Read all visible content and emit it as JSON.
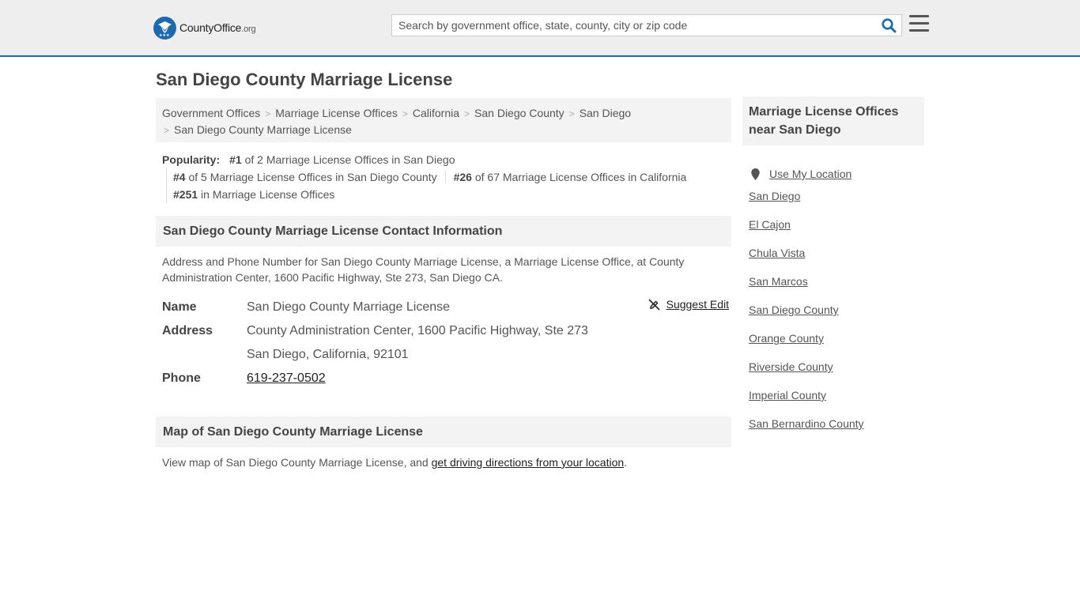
{
  "header": {
    "logo_brand": "CountyOffice",
    "logo_tld": ".org",
    "search_placeholder": "Search by government office, state, county, city or zip code"
  },
  "page_title": "San Diego County Marriage License",
  "breadcrumb": [
    "Government Offices",
    "Marriage License Offices",
    "California",
    "San Diego County",
    "San Diego",
    "San Diego County Marriage License"
  ],
  "popularity": {
    "label": "Popularity:",
    "items": [
      {
        "rank": "#1",
        "text": " of 2 Marriage License Offices in San Diego"
      },
      {
        "rank": "#4",
        "text": " of 5 Marriage License Offices in San Diego County"
      },
      {
        "rank": "#26",
        "text": " of 67 Marriage License Offices in California"
      },
      {
        "rank": "#251",
        "text": " in Marriage License Offices"
      }
    ]
  },
  "contact": {
    "heading": "San Diego County Marriage License Contact Information",
    "description": "Address and Phone Number for San Diego County Marriage License, a Marriage License Office, at County Administration Center, 1600 Pacific Highway, Ste 273, San Diego CA.",
    "suggest_edit": "Suggest Edit",
    "name_label": "Name",
    "name": "San Diego County Marriage License",
    "address_label": "Address",
    "address_line1": "County Administration Center, 1600 Pacific Highway, Ste 273",
    "address_line2": "San Diego, California, 92101",
    "phone_label": "Phone",
    "phone": "619-237-0502"
  },
  "map": {
    "heading": "Map of San Diego County Marriage License",
    "text": "View map of San Diego County Marriage License, and ",
    "link": "get driving directions from your location",
    "suffix": "."
  },
  "sidebar": {
    "heading": "Marriage License Offices near San Diego",
    "use_location": "Use My Location",
    "links": [
      "San Diego",
      "El Cajon",
      "Chula Vista",
      "San Marcos",
      "San Diego County",
      "Orange County",
      "Riverside County",
      "Imperial County",
      "San Bernardino County"
    ]
  },
  "colors": {
    "accent": "#1a6bb3",
    "header_bg": "#eeeeee",
    "panel_bg": "#f3f3f3"
  }
}
